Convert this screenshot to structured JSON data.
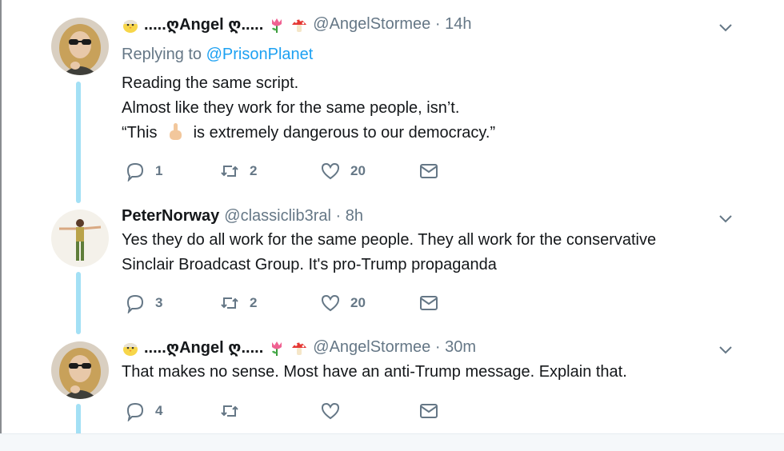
{
  "tweets": [
    {
      "display_name": ".....ღAngel ღ.....",
      "handle": "@AngelStormee",
      "time": "14h",
      "replying_label": "Replying to",
      "replying_handle": "@PrisonPlanet",
      "lines": [
        "Reading the same script.",
        "Almost like they work for the same people, isn’t.",
        "“This",
        "is extremely dangerous to our democracy.”"
      ],
      "replies": "1",
      "retweets": "2",
      "likes": "20"
    },
    {
      "display_name": "PeterNorway",
      "handle": "@classiclib3ral",
      "time": "8h",
      "lines": [
        "Yes they do all work for the same people. They all work for the conservative",
        "Sinclair Broadcast Group. It's pro-Trump propaganda"
      ],
      "replies": "3",
      "retweets": "2",
      "likes": "20"
    },
    {
      "display_name": ".....ღAngel ღ.....",
      "handle": "@AngelStormee",
      "time": "30m",
      "lines": [
        "That makes no sense. Most have an anti-Trump message. Explain that."
      ],
      "replies": "4",
      "retweets": "",
      "likes": ""
    }
  ],
  "colors": {
    "thread_line": "#a3e0f5",
    "link": "#1da1f2",
    "muted": "#657786"
  },
  "icons": [
    "chick-emoji",
    "tulip-emoji",
    "mushroom-emoji",
    "pointing-finger-emoji",
    "chevron-down-icon",
    "reply-icon",
    "retweet-icon",
    "like-icon",
    "message-icon"
  ]
}
